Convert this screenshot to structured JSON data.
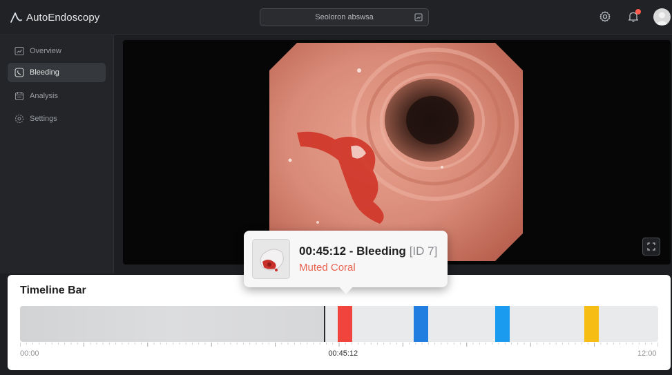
{
  "app": {
    "name": "AutoEndoscopy"
  },
  "search": {
    "text": "Seoloron abswsa"
  },
  "header": {
    "icons": [
      "gear-icon",
      "bell-icon",
      "avatar"
    ],
    "notification_dot": "#ff5a4e"
  },
  "sidebar": {
    "items": [
      {
        "label": "Overview",
        "icon": "chart-icon",
        "active": false
      },
      {
        "label": "Bleeding",
        "icon": "bleeding-icon",
        "active": true
      },
      {
        "label": "Analysis",
        "icon": "calendar-icon",
        "active": false
      },
      {
        "label": "Settings",
        "icon": "gear-icon",
        "active": false
      }
    ]
  },
  "video": {
    "fullscreen_icon": "fullscreen-icon"
  },
  "tooltip": {
    "title": "00:45:12 - Bleeding",
    "id": "[ID 7]",
    "subtitle": "Muted Coral"
  },
  "timeline": {
    "title": "Timeline Bar",
    "start_label": "00:00",
    "current_label": "00:45:12",
    "end_label": "12:00",
    "played_fraction": 0.477,
    "markers": [
      {
        "name": "bleeding",
        "position": 0.509,
        "color": "#f0443d"
      },
      {
        "name": "event-blue-1",
        "position": 0.628,
        "color": "#1f7ee0"
      },
      {
        "name": "event-blue-2",
        "position": 0.755,
        "color": "#1a9bf0"
      },
      {
        "name": "event-yellow",
        "position": 0.895,
        "color": "#f6bd15"
      }
    ]
  }
}
